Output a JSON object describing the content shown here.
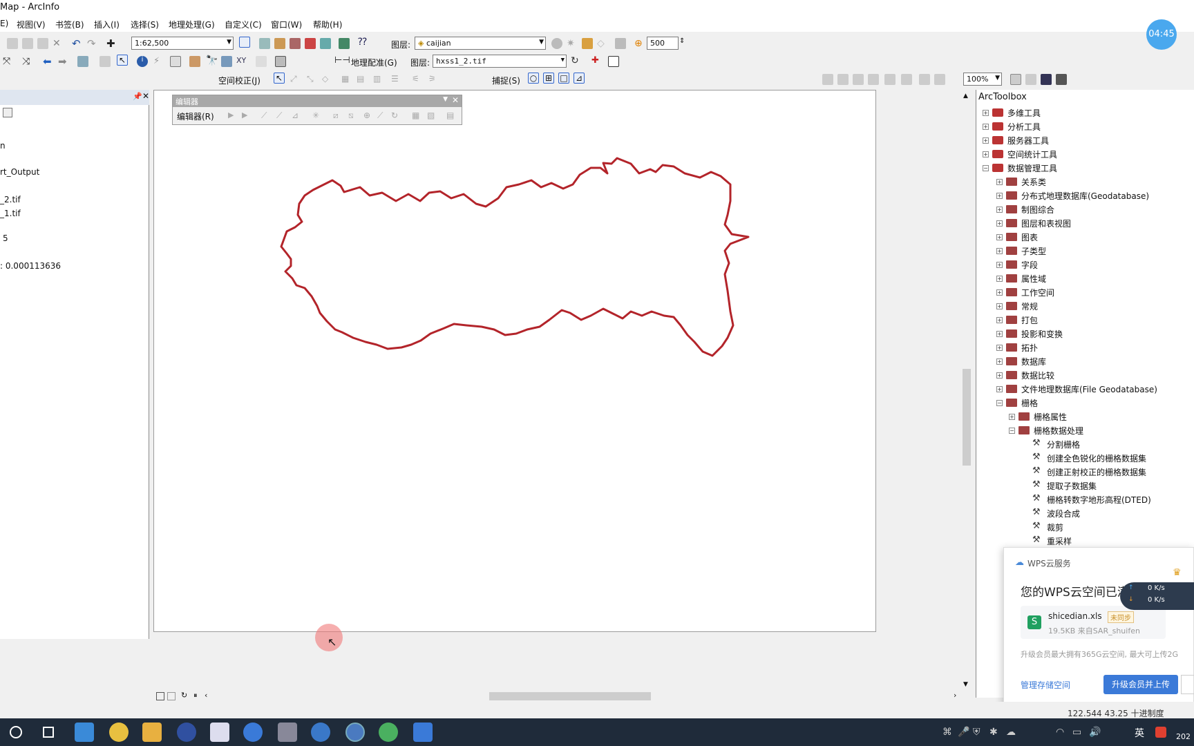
{
  "window": {
    "title": "Map - ArcInfo"
  },
  "menu": [
    "E)",
    "视图(V)",
    "书签(B)",
    "插入(I)",
    "选择(S)",
    "地理处理(G)",
    "自定义(C)",
    "窗口(W)",
    "帮助(H)"
  ],
  "toolbar": {
    "scale": "1:62,500",
    "layer_label": "图层:",
    "layer_value": "caijian",
    "snap_value": "500",
    "georef_label": "地理配准(G)",
    "georef_layer_label": "图层:",
    "georef_layer_value": "hxss1_2.tif",
    "spatial_adjust_label": "空间校正(J)",
    "snapping_label": "捕捉(S)",
    "zoom_value": "100%"
  },
  "toc": {
    "lines": [
      "n",
      "rt_Output",
      "_2.tif",
      "_1.tif",
      "5",
      ": 0.000113636"
    ]
  },
  "editor": {
    "title": "编辑器",
    "menu_label": "编辑器(R)"
  },
  "toolbox": {
    "title": "ArcToolbox",
    "top_items": [
      "多维工具",
      "分析工具",
      "服务器工具",
      "空间统计工具",
      "数据管理工具"
    ],
    "data_mgmt_children": [
      "关系类",
      "分布式地理数据库(Geodatabase)",
      "制图综合",
      "图层和表视图",
      "图表",
      "子类型",
      "字段",
      "属性域",
      "工作空间",
      "常规",
      "打包",
      "投影和变换",
      "拓扑",
      "数据库",
      "数据比较",
      "文件地理数据库(File Geodatabase)",
      "栅格"
    ],
    "raster_children": [
      "栅格属性",
      "栅格数据处理"
    ],
    "raster_processing_tools": [
      "分割栅格",
      "创建全色锐化的栅格数据集",
      "创建正射校正的栅格数据集",
      "提取子数据集",
      "栅格转数字地形高程(DTED)",
      "波段合成",
      "裁剪",
      "重采样"
    ]
  },
  "wps": {
    "service": "WPS云服务",
    "headline": "您的WPS云空间已满",
    "file_name": "shicedian.xls",
    "sync_badge": "未同步",
    "file_meta": "19.5KB  来自SAR_shuifen",
    "upsell": "升级会员最大拥有365G云空间, 最大可上传2G",
    "manage": "管理存储空间",
    "upgrade_button": "升级会员并上传",
    "net_up": "0 K/s",
    "net_down": "0 K/s"
  },
  "status": {
    "coords": "122.544  43.25 十进制度"
  },
  "timer": "04:45",
  "taskbar": {
    "ime": "英",
    "clock": "202"
  }
}
